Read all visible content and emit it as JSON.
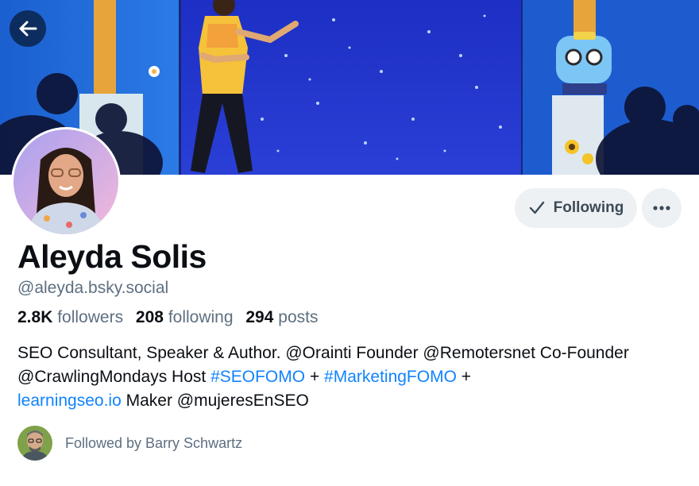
{
  "profile": {
    "display_name": "Aleyda Solis",
    "handle": "@aleyda.bsky.social",
    "stats": {
      "followers_count": "2.8K",
      "followers_label": "followers",
      "following_count": "208",
      "following_label": "following",
      "posts_count": "294",
      "posts_label": "posts"
    },
    "bio": {
      "part1": "SEO Consultant, Speaker & Author. @Orainti Founder @Remotersnet Co-Founder @CrawlingMondays Host ",
      "tag1": "#SEOFOMO",
      "sep1": " + ",
      "tag2": "#MarketingFOMO",
      "sep2": " +",
      "link": "learningseo.io",
      "part2": " Maker @mujeresEnSEO"
    },
    "followed_by": "Followed by Barry Schwartz"
  },
  "actions": {
    "following_label": "Following"
  },
  "icons": {
    "back": "arrow-left-icon",
    "following": "check-icon",
    "more": "ellipsis-icon"
  },
  "colors": {
    "link": "#1083fe",
    "muted_text": "#5d6f80",
    "button_bg": "#eef1f4",
    "banner_blue": "#2437c8"
  }
}
